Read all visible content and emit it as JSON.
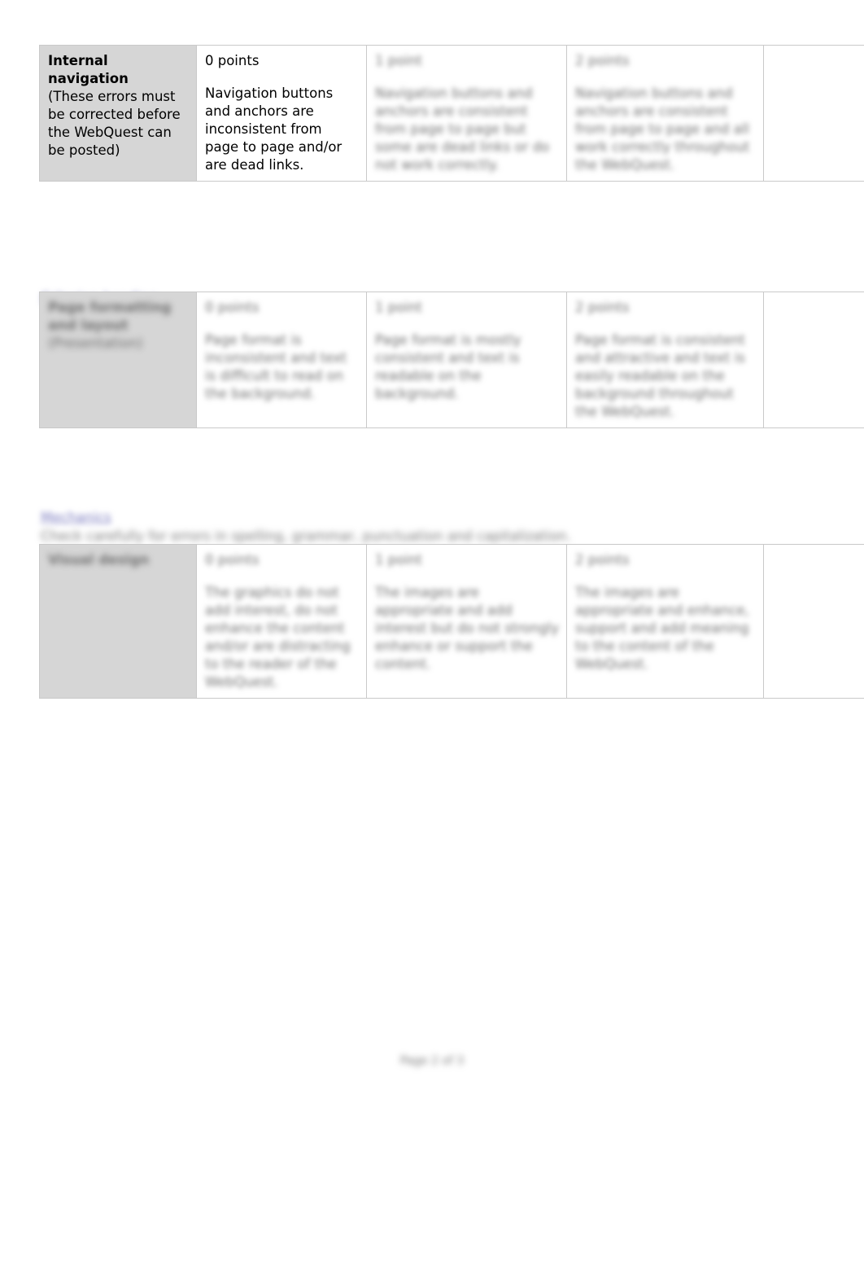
{
  "document": {
    "type": "rubric-table-page",
    "background_color": "#ffffff",
    "criteria_cell_color": "#d6d6d6",
    "border_color": "#c9c9c9",
    "link_color": "#7b7bbf"
  },
  "tables": [
    {
      "id": "table-navigation",
      "rows": [
        {
          "criterion_title": "Internal navigation",
          "criterion_note": "(These errors must be corrected before the WebQuest can be posted)",
          "level_0_points": "0 points",
          "level_0_description": "Navigation buttons and anchors are inconsistent from page to page and/or are dead links.",
          "level_1_points": "1 point",
          "level_1_description": "Navigation buttons and anchors are consistent from page to page but some are dead links or do not work correctly.",
          "level_2_points": "2 points",
          "level_2_description": "Navigation buttons and anchors are consistent from page to page and all work correctly throughout the WebQuest.",
          "score": ""
        }
      ]
    },
    {
      "id": "table-two",
      "rows": [
        {
          "criterion_title": "Page formatting and layout",
          "criterion_note": "(Presentation)",
          "level_0_points": "0 points",
          "level_0_description": "Page format is inconsistent and text is difficult to read on the background.",
          "level_1_points": "1 point",
          "level_1_description": "Page format is mostly consistent and text is readable on the background.",
          "level_2_points": "2 points",
          "level_2_description": "Page format is consistent and attractive and text is easily readable on the background throughout the WebQuest.",
          "score": ""
        }
      ]
    },
    {
      "id": "table-three",
      "rows": [
        {
          "criterion_title": "Visual design",
          "criterion_note": "",
          "level_0_points": "0 points",
          "level_0_description": "The graphics do not add interest, do not enhance the content and/or are distracting to the reader of the WebQuest.",
          "level_1_points": "1 point",
          "level_1_description": "The images are appropriate and add interest but do not strongly enhance or support the content.",
          "level_2_points": "2 points",
          "level_2_description": "The images are appropriate and enhance, support and add meaning to the content of the WebQuest.",
          "score": ""
        }
      ]
    }
  ],
  "between_notes": {
    "note_1": "Criterion heading",
    "note_2": "Mechanics",
    "note_3": "Check carefully for errors in spelling, grammar, punctuation and capitalization."
  },
  "footer": {
    "text": "Page 2 of 3"
  }
}
